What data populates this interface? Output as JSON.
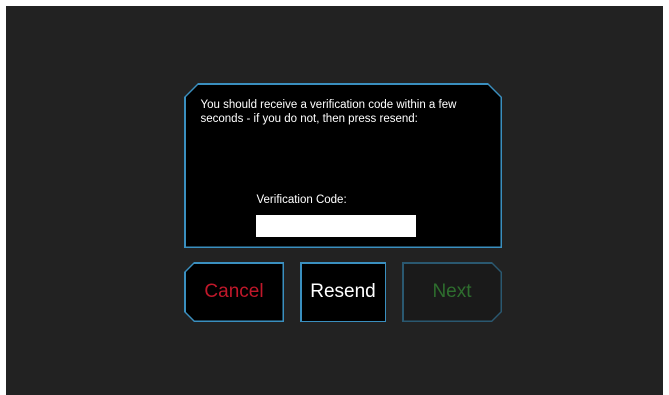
{
  "dialog": {
    "message": "You should receive a verification code within a few seconds - if you do not, then press resend:",
    "code_label": "Verification Code:",
    "code_value": "",
    "code_placeholder": ""
  },
  "buttons": {
    "cancel_label": "Cancel",
    "resend_label": "Resend",
    "next_label": "Next"
  },
  "colors": {
    "background": "#222222",
    "panel": "#000000",
    "border_accent": "#3a8fbf",
    "cancel_text": "#c0182a",
    "next_text_disabled": "#2e6e2e"
  }
}
